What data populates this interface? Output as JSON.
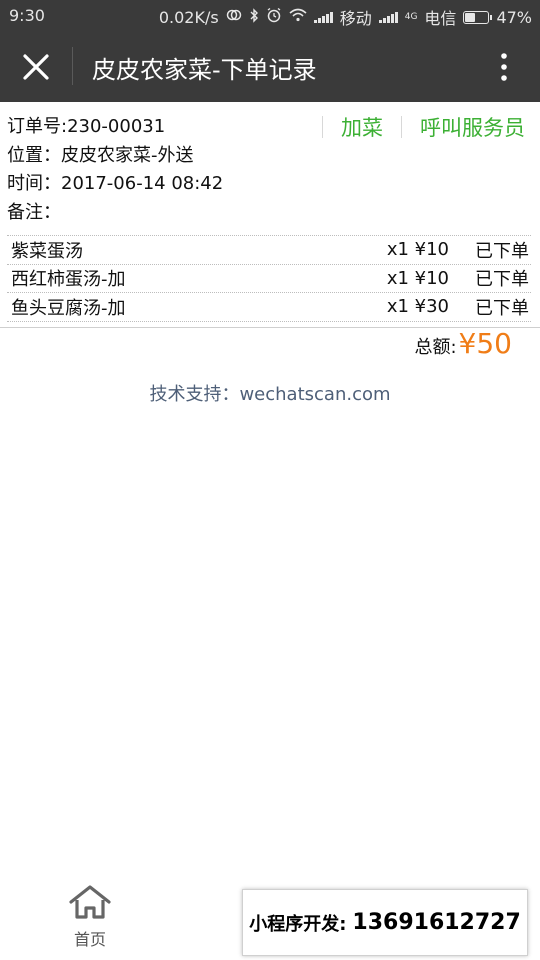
{
  "status_bar": {
    "time": "9:30",
    "net_speed": "0.02K/s",
    "carrier1": "移动",
    "carrier2": "电信",
    "network_type": "4G",
    "battery": "47%",
    "battery_level": 0.47
  },
  "header": {
    "title": "皮皮农家菜-下单记录",
    "close_icon": "close-icon",
    "more_icon": "more-vertical-icon"
  },
  "order": {
    "number": "订单号:230-00031",
    "location": "位置：皮皮农家菜-外送",
    "time": "时间：2017-06-14 08:42",
    "remark": "备注："
  },
  "actions": {
    "add_dish": "加菜",
    "call_waiter": "呼叫服务员"
  },
  "items": [
    {
      "name": "紫菜蛋汤",
      "qty_price": "x1 ¥10",
      "status": "已下单"
    },
    {
      "name": "西红柿蛋汤-加",
      "qty_price": "x1 ¥10",
      "status": "已下单"
    },
    {
      "name": "鱼头豆腐汤-加",
      "qty_price": "x1 ¥30",
      "status": "已下单"
    }
  ],
  "total": {
    "label": "总额:",
    "amount": "¥50"
  },
  "support": "技术支持：wechatscan.com",
  "tabbar": {
    "home_label": "首页",
    "home_icon": "home-icon"
  },
  "promo": {
    "label": "小程序开发:",
    "phone": "13691612727"
  },
  "colors": {
    "header_bg": "#3a3a3a",
    "action_green": "#3cb034",
    "total_orange": "#f07d17",
    "support_text": "#4e5f78"
  }
}
